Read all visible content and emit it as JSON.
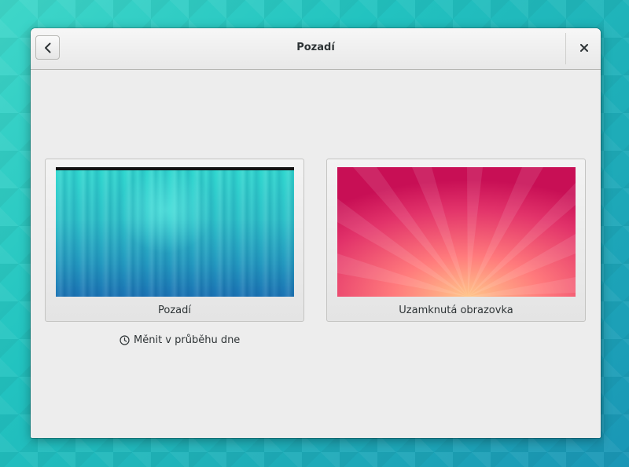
{
  "window": {
    "title": "Pozadí"
  },
  "cards": [
    {
      "label": "Pozadí"
    },
    {
      "label": "Uzamknutá obrazovka"
    }
  ],
  "change_note": {
    "text": "Měnit v průběhu dne",
    "icon": "clock-icon"
  },
  "icons": {
    "back": "go-back-icon",
    "close": "close-icon"
  },
  "colors": {
    "desktop": "#22c3c0",
    "window_bg": "#ededed",
    "lock_wallpaper": "#d4195a"
  }
}
